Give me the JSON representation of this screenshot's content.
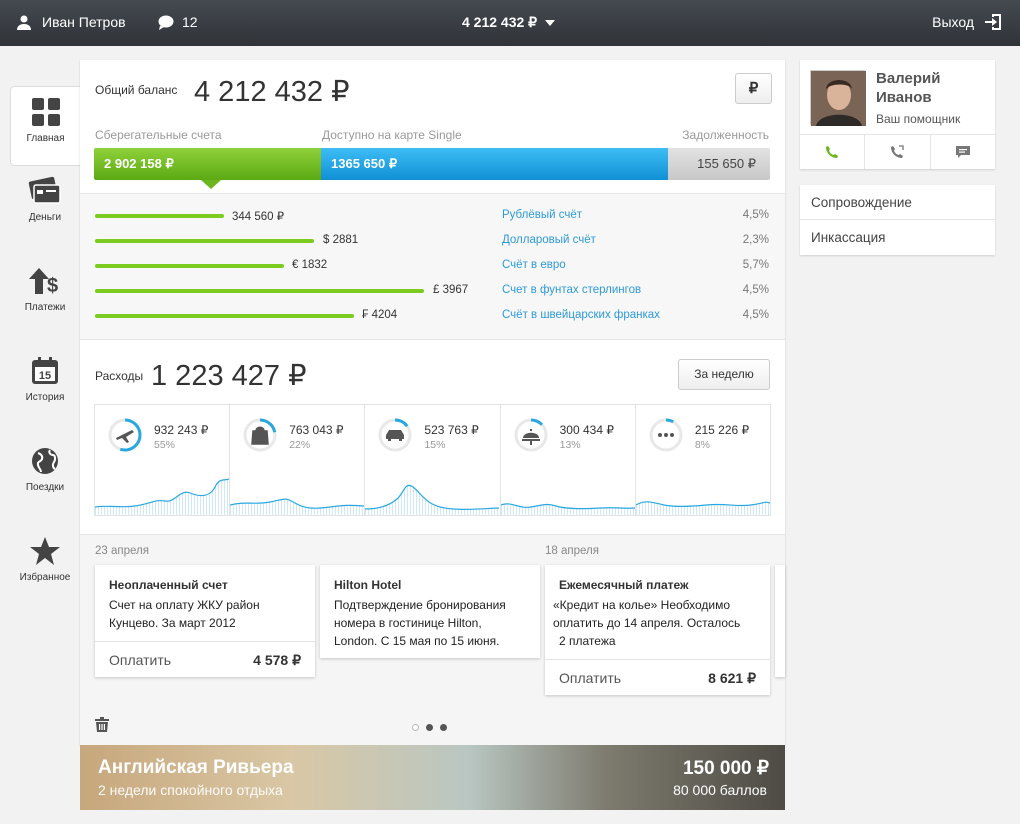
{
  "topbar": {
    "user_name": "Иван Петров",
    "messages_count": "12",
    "balance": "4 212 432 ₽",
    "logout": "Выход"
  },
  "nav": [
    {
      "label": "Главная",
      "icon": "grid-icon"
    },
    {
      "label": "Деньги",
      "icon": "cards-icon"
    },
    {
      "label": "Платежи",
      "icon": "transfer-icon"
    },
    {
      "label": "История",
      "icon": "calendar-icon"
    },
    {
      "label": "Поездки",
      "icon": "globe-icon"
    },
    {
      "label": "Избранное",
      "icon": "star-icon"
    }
  ],
  "calendar_day": "15",
  "balance": {
    "label": "Общий баланс",
    "value": "4 212 432 ₽",
    "currency_button": "₽",
    "segments": [
      {
        "label": "Сберегательные счета",
        "value": "2 902 158 ₽",
        "color": "#6bb51e"
      },
      {
        "label": "Доступно на карте Single",
        "value": "1365 650 ₽",
        "color": "#1aa3e4"
      },
      {
        "label": "Задолженность",
        "value": "155 650 ₽",
        "color": "#cfcfcf"
      }
    ]
  },
  "accounts": [
    {
      "amount": "344 560 ₽",
      "name": "Рублёвый счёт",
      "percent": "4,5%"
    },
    {
      "amount": "$ 2881",
      "name": "Долларовый счёт",
      "percent": "2,3%"
    },
    {
      "amount": "€ 1832",
      "name": "Счёт в евро",
      "percent": "5,7%"
    },
    {
      "amount": "£ 3967",
      "name": "Счет в фунтах стерлингов",
      "percent": "4,5%"
    },
    {
      "amount": "₣ 4204",
      "name": "Счёт в швейцарских франках",
      "percent": "4,5%"
    }
  ],
  "expenses": {
    "label": "Расходы",
    "value": "1 223 427 ₽",
    "period_button": "За неделю",
    "categories": [
      {
        "value": "932 243 ₽",
        "percent": "55%",
        "share": 0.55,
        "icon": "plane-icon"
      },
      {
        "value": "763 043 ₽",
        "percent": "22%",
        "share": 0.22,
        "icon": "shopping-bag-icon"
      },
      {
        "value": "523 763 ₽",
        "percent": "15%",
        "share": 0.15,
        "icon": "car-icon"
      },
      {
        "value": "300 434 ₽",
        "percent": "13%",
        "share": 0.13,
        "icon": "food-icon"
      },
      {
        "value": "215 226 ₽",
        "percent": "8%",
        "share": 0.08,
        "icon": "more-icon"
      }
    ]
  },
  "feed": {
    "dates": [
      "23 апреля",
      "18 апреля"
    ],
    "cards": [
      {
        "title": "Неоплаченный счет",
        "body": [
          "Счет на оплату ЖКУ район",
          "Кунцево.  За март 2012"
        ],
        "pay": "Оплатить",
        "sum": "4 578 ₽"
      },
      {
        "title": "Hilton Hotel",
        "body": [
          "Подтверждение бронирования",
          "номера в гостинице Hilton,",
          "London. С 15 мая по 15 июня."
        ]
      },
      {
        "title": "Ежемесячный платеж",
        "body": [
          "«Кредит на колье» Необходимо",
          "оплатить до 14 апреля. Осталось",
          "2 платежа"
        ],
        "pay": "Оплатить",
        "sum": "8 621 ₽"
      }
    ]
  },
  "promo": {
    "title": "Английская Ривьера",
    "subtitle": "2 недели спокойного отдыха",
    "price": "150 000 ₽",
    "points": "80 000 баллов"
  },
  "assistant": {
    "first_name": "Валерий",
    "last_name": "Иванов",
    "role": "Ваш помощник"
  },
  "services": [
    "Сопровождение",
    "Инкассация"
  ],
  "colors": {
    "green": "#6bb51e",
    "blue": "#1aa3e4",
    "link": "#2e9ad6",
    "wave": "#29a8e0"
  }
}
